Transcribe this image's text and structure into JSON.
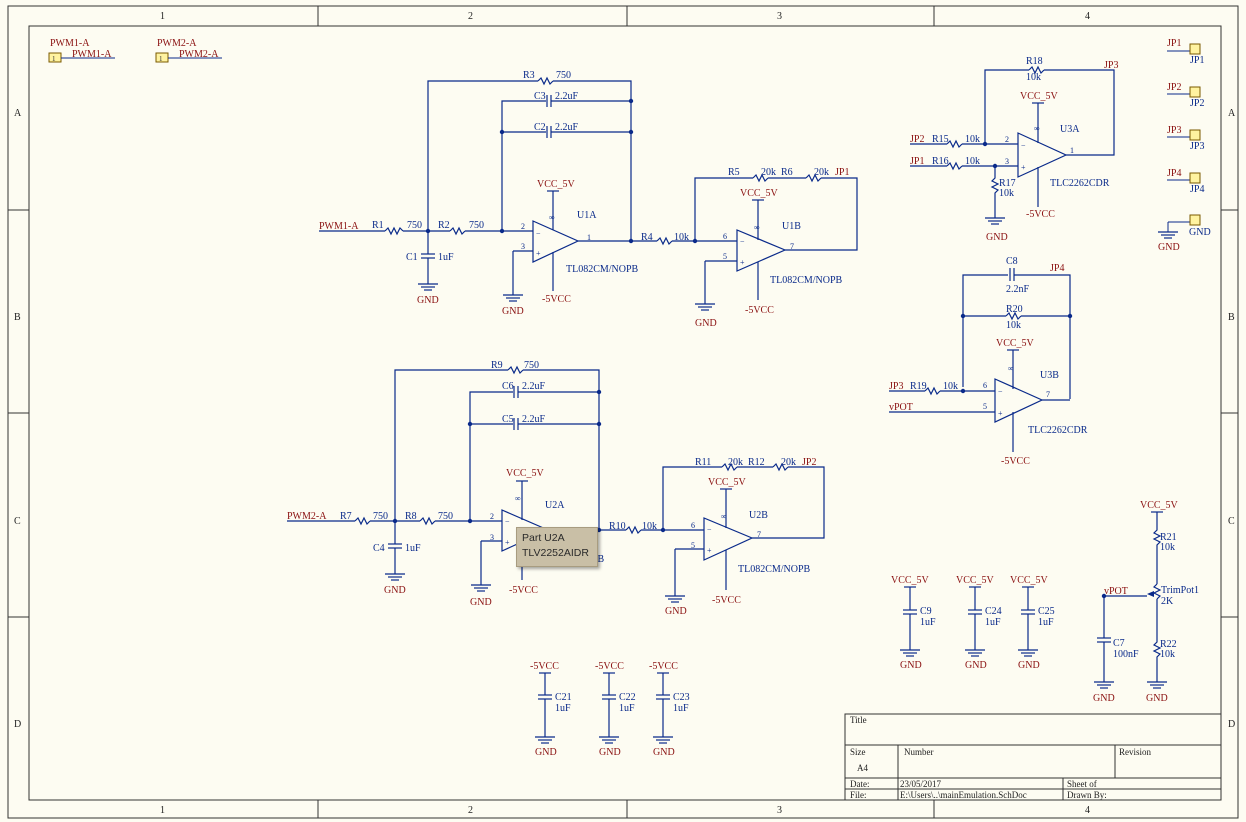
{
  "frame": {
    "columns": [
      "1",
      "2",
      "3",
      "4"
    ],
    "rows": [
      "A",
      "B",
      "C",
      "D"
    ]
  },
  "ports": {
    "pwm1": "PWM1-A",
    "pwm2": "PWM2-A",
    "jp1": "JP1",
    "jp2": "JP2",
    "jp3": "JP3",
    "jp4": "JP4",
    "gnd": "GND",
    "vpot": "vPOT"
  },
  "power": {
    "vcc": "VCC_5V",
    "vee": "-5VCC",
    "gnd": "GND"
  },
  "components": {
    "R1": "R1",
    "R1v": "750",
    "R2": "R2",
    "R2v": "750",
    "R3": "R3",
    "R3v": "750",
    "R4": "R4",
    "R4v": "10k",
    "R5": "R5",
    "R5v": "20k",
    "R6": "R6",
    "R6v": "20k",
    "R7": "R7",
    "R7v": "750",
    "R8": "R8",
    "R8v": "750",
    "R9": "R9",
    "R9v": "750",
    "R10": "R10",
    "R10v": "10k",
    "R11": "R11",
    "R11v": "20k",
    "R12": "R12",
    "R12v": "20k",
    "R15": "R15",
    "R15v": "10k",
    "R16": "R16",
    "R16v": "10k",
    "R17": "R17",
    "R17v": "10k",
    "R18": "R18",
    "R18v": "10k",
    "R19": "R19",
    "R19v": "10k",
    "R20": "R20",
    "R20v": "10k",
    "R21": "R21",
    "R21v": "10k",
    "R22": "R22",
    "R22v": "10k",
    "C1": "C1",
    "C1v": "1uF",
    "C2": "C2",
    "C2v": "2.2uF",
    "C3": "C3",
    "C3v": "2.2uF",
    "C4": "C4",
    "C4v": "1uF",
    "C5": "C5",
    "C5v": "2.2uF",
    "C6": "C6",
    "C6v": "2.2uF",
    "C7": "C7",
    "C7v": "100nF",
    "C8": "C8",
    "C8v": "2.2nF",
    "C9": "C9",
    "C9v": "1uF",
    "C21": "C21",
    "C21v": "1uF",
    "C22": "C22",
    "C22v": "1uF",
    "C23": "C23",
    "C23v": "1uF",
    "C24": "C24",
    "C24v": "1uF",
    "C25": "C25",
    "C25v": "1uF",
    "U1A": "U1A",
    "U1B": "U1B",
    "U2A": "U2A",
    "U2B": "U2B",
    "U3A": "U3A",
    "U3B": "U3B",
    "tl082": "TL082CM/NOPB",
    "tlc2262": "TLC2262CDR",
    "trimpot": "TrimPot1",
    "trimpotv": "2K"
  },
  "tooltip": {
    "line1": "Part U2A",
    "line2": "TLV2252AIDR"
  },
  "title_block": {
    "title_label": "Title",
    "size_label": "Size",
    "size_value": "A4",
    "number_label": "Number",
    "revision_label": "Revision",
    "date_label": "Date:",
    "date_value": "23/05/2017",
    "file_label": "File:",
    "file_value": "E:\\Users\\..\\mainEmulation.SchDoc",
    "sheet_label": "Sheet    of",
    "drawn_label": "Drawn By:"
  }
}
